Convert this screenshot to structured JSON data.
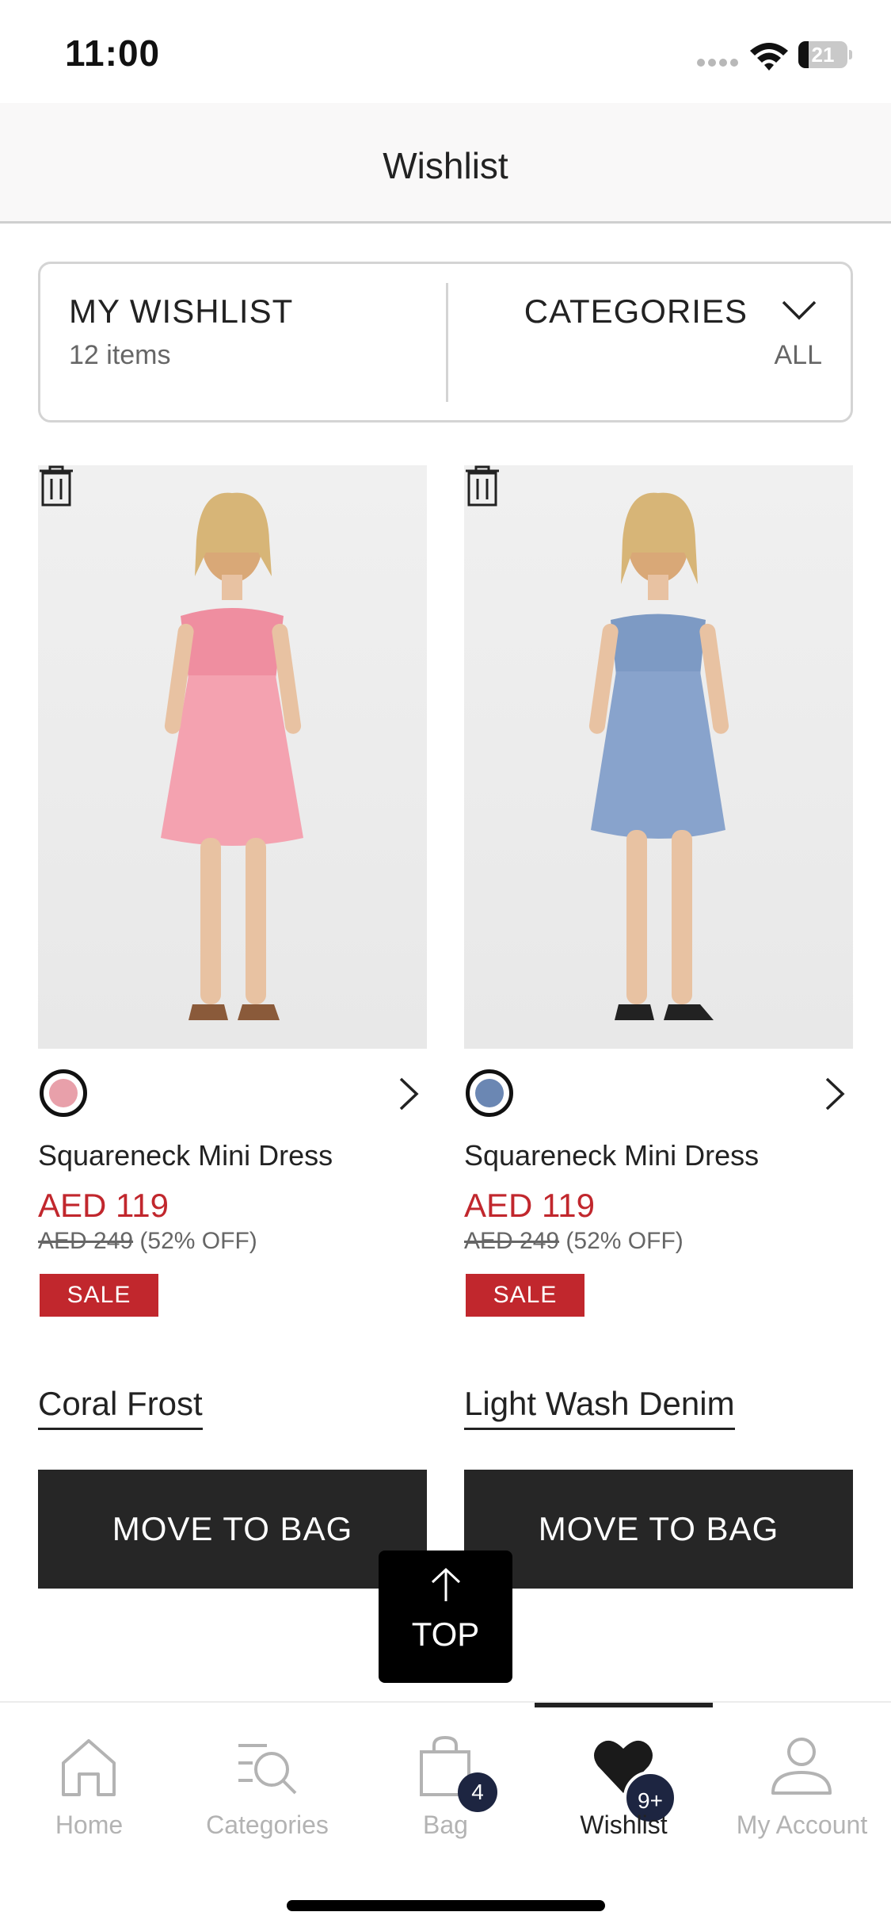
{
  "status_bar": {
    "time": "11:00",
    "battery": "21",
    "battery_level": 0.21
  },
  "header": {
    "title": "Wishlist"
  },
  "summary": {
    "label": "MY WISHLIST",
    "count": "12 items",
    "categories_label": "CATEGORIES",
    "categories_value": "ALL"
  },
  "products": [
    {
      "name": "Squareneck Mini Dress",
      "price": "AED 119",
      "original_price": "AED 249",
      "discount": "(52% OFF)",
      "badge": "SALE",
      "color_name": "Coral Frost",
      "swatch_color": "#e8a0aa",
      "move_label": "MOVE TO BAG"
    },
    {
      "name": "Squareneck Mini Dress",
      "price": "AED 119",
      "original_price": "AED 249",
      "discount": "(52% OFF)",
      "badge": "SALE",
      "color_name": "Light Wash Denim",
      "swatch_color": "#6b87b3",
      "move_label": "MOVE TO BAG"
    }
  ],
  "top_button": {
    "label": "TOP"
  },
  "tabbar": {
    "tabs": [
      {
        "label": "Home",
        "icon": "home-icon"
      },
      {
        "label": "Categories",
        "icon": "categories-search-icon"
      },
      {
        "label": "Bag",
        "icon": "bag-icon",
        "badge": "4"
      },
      {
        "label": "Wishlist",
        "icon": "heart-icon",
        "badge": "9+",
        "active": true
      },
      {
        "label": "My Account",
        "icon": "account-icon"
      }
    ]
  },
  "colors": {
    "sale_red": "#c1272d",
    "button_dark": "#262626",
    "badge_navy": "#1d2541"
  }
}
